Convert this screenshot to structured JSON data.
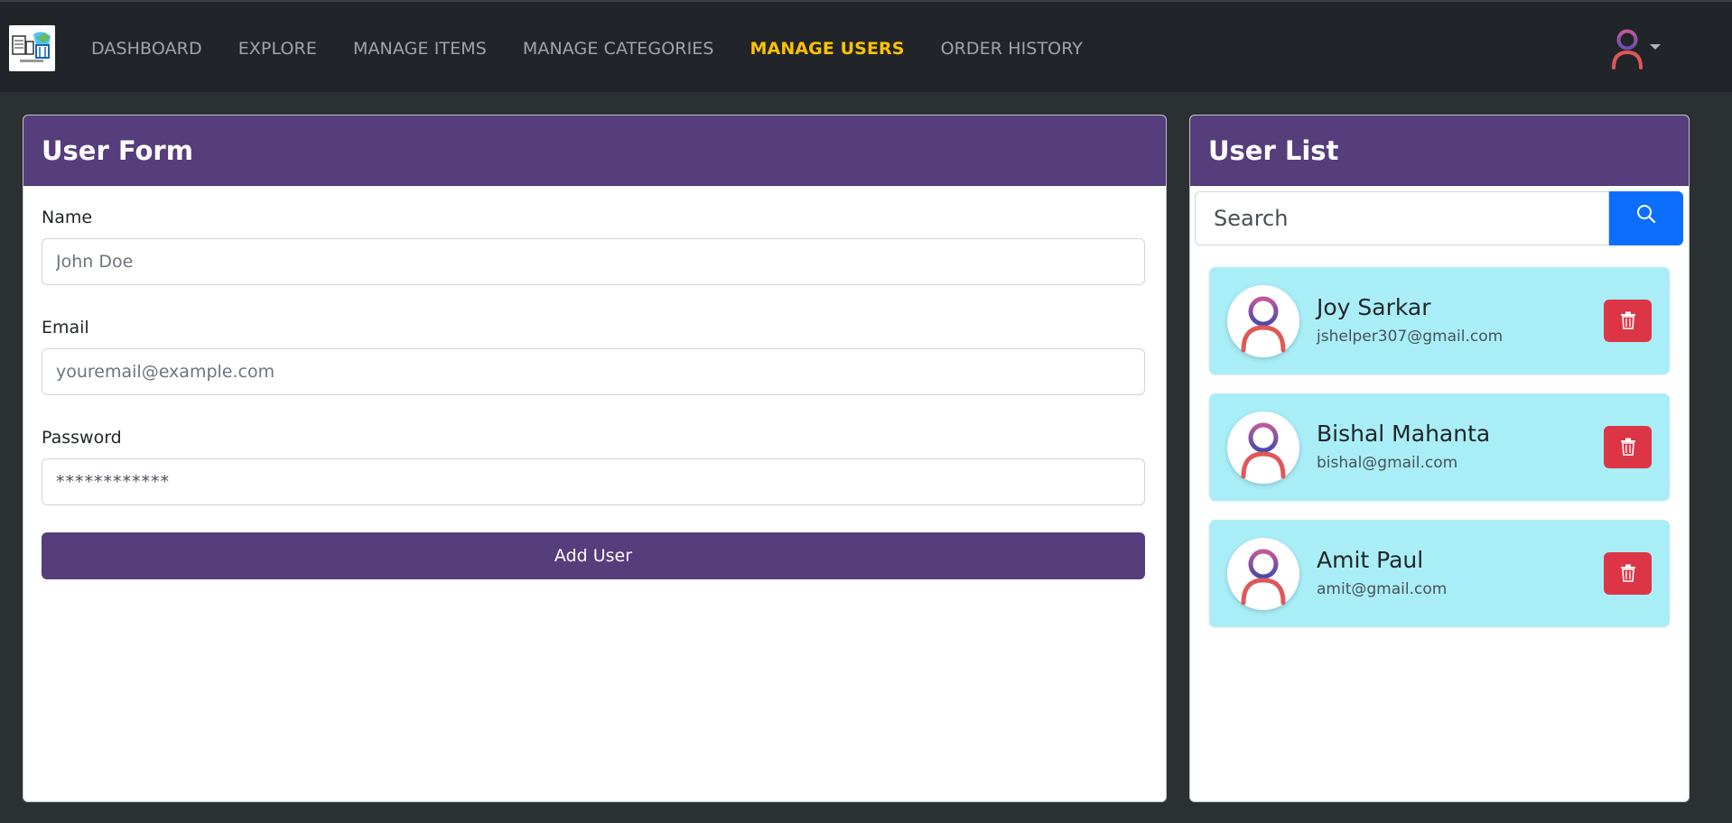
{
  "navbar": {
    "logo_icon": "app-logo-icon",
    "links": [
      {
        "label": "DASHBOARD",
        "active": false
      },
      {
        "label": "EXPLORE",
        "active": false
      },
      {
        "label": "MANAGE ITEMS",
        "active": false
      },
      {
        "label": "MANAGE CATEGORIES",
        "active": false
      },
      {
        "label": "MANAGE USERS",
        "active": true
      },
      {
        "label": "ORDER HISTORY",
        "active": false
      }
    ],
    "user_icon": "user-avatar-icon",
    "dropdown_icon": "caret-down-icon"
  },
  "form": {
    "title": "User Form",
    "name_label": "Name",
    "name_placeholder": "John Doe",
    "email_label": "Email",
    "email_placeholder": "youremail@example.com",
    "password_label": "Password",
    "password_placeholder": "************",
    "submit_label": "Add User"
  },
  "user_list": {
    "title": "User List",
    "search_placeholder": "Search",
    "search_icon": "search-icon",
    "delete_icon": "trash-icon",
    "users": [
      {
        "name": "Joy Sarkar",
        "email": "jshelper307@gmail.com"
      },
      {
        "name": "Bishal Mahanta",
        "email": "bishal@gmail.com"
      },
      {
        "name": "Amit Paul",
        "email": "amit@gmail.com"
      }
    ]
  },
  "colors": {
    "navbar_bg": "#212529",
    "page_bg": "#2b3133",
    "header_purple": "#563d7c",
    "active_link": "#ffc107",
    "search_button": "#0d6efd",
    "user_card_bg": "#a9eef7",
    "delete_button": "#dc3545"
  }
}
